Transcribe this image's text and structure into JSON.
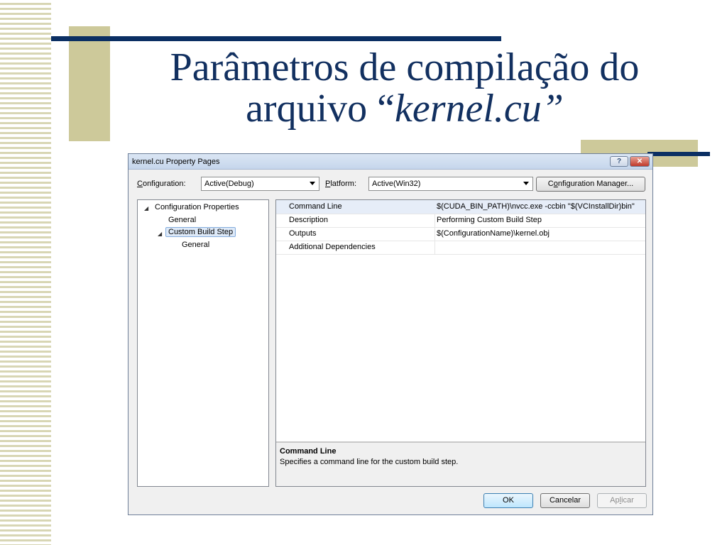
{
  "slide": {
    "title_line1": "Parâmetros de compilação do",
    "title_line2_prefix": "arquivo “",
    "title_line2_italic": "kernel.cu",
    "title_line2_suffix": "”"
  },
  "dialog": {
    "title": "kernel.cu Property Pages",
    "help_label": "?",
    "close_label": "✕",
    "configuration_label_prefix": "",
    "configuration_label_underline": "C",
    "configuration_label_rest": "onfiguration:",
    "configuration_value": "Active(Debug)",
    "platform_label_underline": "P",
    "platform_label_rest": "latform:",
    "platform_value": "Active(Win32)",
    "config_manager_prefix": "C",
    "config_manager_underline": "o",
    "config_manager_rest": "nfiguration Manager...",
    "tree": [
      {
        "label": "Configuration Properties",
        "level": 0,
        "expanded": true
      },
      {
        "label": "General",
        "level": 1
      },
      {
        "label": "Custom Build Step",
        "level": 1,
        "expanded": true,
        "selected": true
      },
      {
        "label": "General",
        "level": 2
      }
    ],
    "properties": [
      {
        "name": "Command Line",
        "value": "$(CUDA_BIN_PATH)\\nvcc.exe -ccbin \"$(VCInstallDir)bin\""
      },
      {
        "name": "Description",
        "value": "Performing Custom Build Step"
      },
      {
        "name": "Outputs",
        "value": "$(ConfigurationName)\\kernel.obj"
      },
      {
        "name": "Additional Dependencies",
        "value": ""
      }
    ],
    "description_title": "Command Line",
    "description_text": "Specifies a command line for the custom build step.",
    "ok_label": "OK",
    "cancel_label": "Cancelar",
    "apply_prefix": "Ap",
    "apply_underline": "l",
    "apply_rest": "icar"
  }
}
